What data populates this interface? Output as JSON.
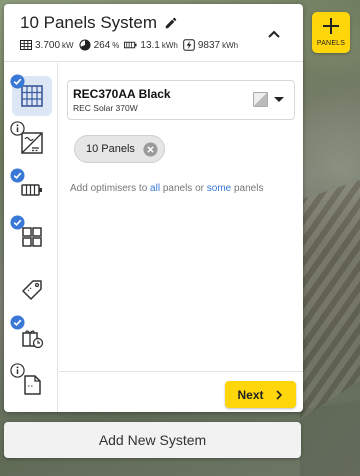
{
  "system": {
    "title": "10 Panels System",
    "stats": {
      "power_value": "3.700",
      "power_unit": "kW",
      "ratio_value": "264",
      "ratio_unit": "%",
      "battery_value": "13.1",
      "battery_unit": "kWh",
      "energy_value": "9837",
      "energy_unit": "kWh"
    }
  },
  "panels_button": {
    "label": "PANELS"
  },
  "rail": {
    "items": [
      {
        "icon": "panel-grid-icon",
        "badge": "check",
        "active": true
      },
      {
        "icon": "inverter-icon",
        "badge": "info",
        "active": false
      },
      {
        "icon": "battery-icon",
        "badge": "check",
        "active": false
      },
      {
        "icon": "modules-icon",
        "badge": "check",
        "active": false
      },
      {
        "icon": "price-tag-icon",
        "badge": "none",
        "active": false
      },
      {
        "icon": "extras-icon",
        "badge": "check",
        "active": false
      },
      {
        "icon": "document-icon",
        "badge": "info",
        "active": false
      }
    ]
  },
  "panel_select": {
    "name": "REC370AA Black",
    "subtitle": "REC Solar 370W"
  },
  "chip": {
    "label": "10 Panels"
  },
  "optimisers_hint": {
    "prefix": "Add optimisers to",
    "all_link": "all",
    "middle": "panels or",
    "some_link": "some",
    "suffix": "panels"
  },
  "next_button": {
    "label": "Next"
  },
  "add_system_button": {
    "label": "Add New System"
  },
  "colors": {
    "accent": "#ffd60a",
    "link": "#3a78d6",
    "badge": "#3a78d6",
    "active_bg": "#dde6f5"
  }
}
